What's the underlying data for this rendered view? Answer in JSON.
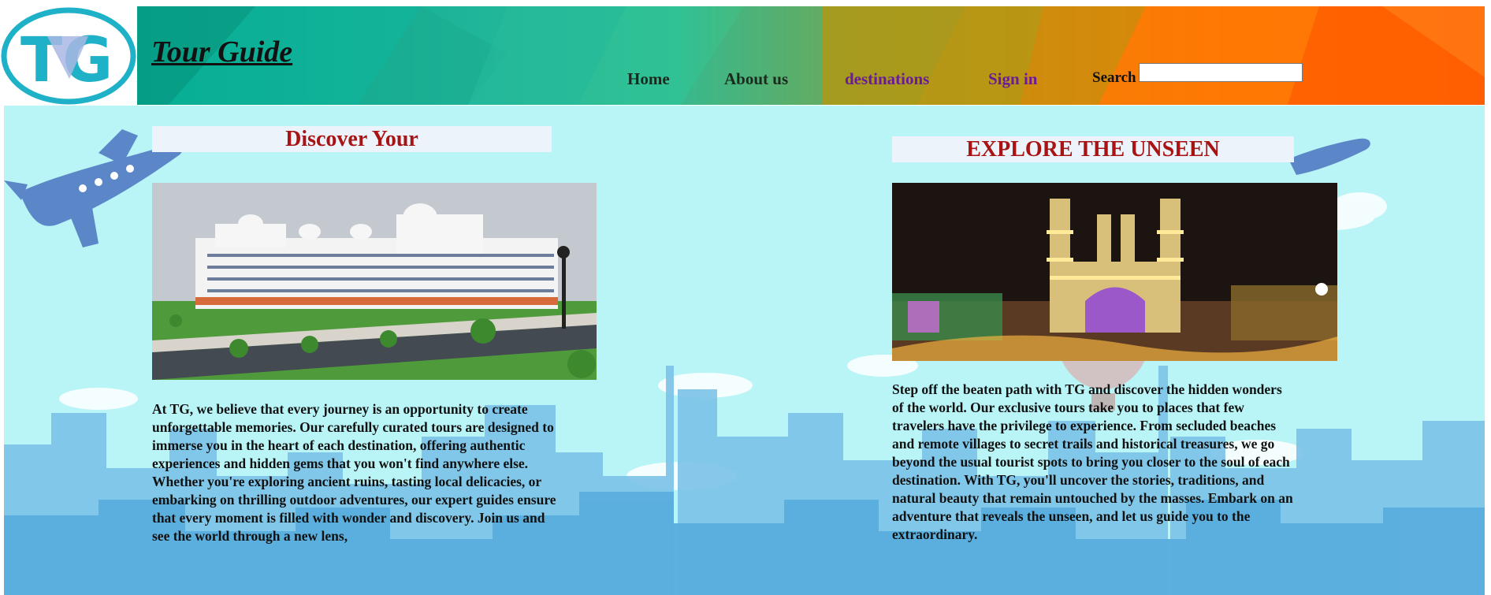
{
  "header": {
    "site_title": "Tour Guide",
    "logo_letters": "TG",
    "nav": [
      {
        "label": "Home"
      },
      {
        "label": "About us"
      },
      {
        "label": "destinations"
      },
      {
        "label": "Sign in"
      }
    ],
    "search_label": "Search",
    "search_value": ""
  },
  "left_panel": {
    "heading": "Discover Your",
    "paragraph": "At TG, we believe that every journey is an opportunity to create unforgettable memories. Our carefully curated tours are designed to immerse you in the heart of each destination, offering authentic experiences and hidden gems that you won't find anywhere else. Whether you're exploring ancient ruins, tasting local delicacies, or embarking on thrilling outdoor adventures, our expert guides ensure that every moment is filled with wonder and discovery. Join us and see the world through a new lens,"
  },
  "right_panel": {
    "heading": "EXPLORE THE UNSEEN",
    "paragraph": "Step off the beaten path with TG and discover the hidden wonders of the world. Our exclusive tours take you to places that few travelers have the privilege to experience. From secluded beaches and remote villages to secret trails and historical treasures, we go beyond the usual tourist spots to bring you closer to the soul of each destination. With TG, you'll uncover the stories, traditions, and natural beauty that remain untouched by the masses. Embark on an adventure that reveals the unseen, and let us guide you to the extraordinary."
  },
  "colors": {
    "heading_red": "#a81414",
    "nav_purple": "#6a1b9a",
    "background_cyan": "#b9f4f6",
    "logo_teal": "#1fb1c8"
  }
}
